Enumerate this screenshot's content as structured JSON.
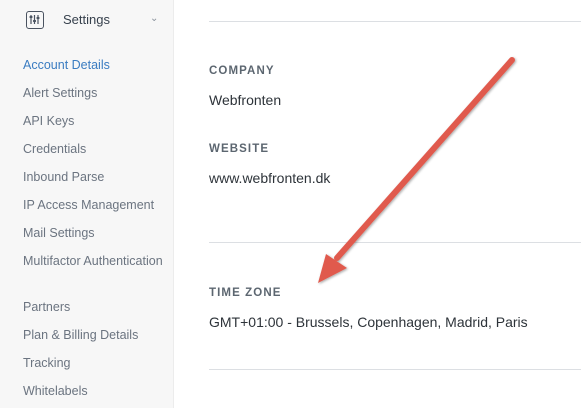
{
  "sidebar": {
    "title": "Settings",
    "icon": "settings-sliders-icon",
    "items": [
      {
        "label": "Account Details",
        "active": true
      },
      {
        "label": "Alert Settings"
      },
      {
        "label": "API Keys"
      },
      {
        "label": "Credentials"
      },
      {
        "label": "Inbound Parse"
      },
      {
        "label": "IP Access Management"
      },
      {
        "label": "Mail Settings"
      },
      {
        "label": "Multifactor Authentication"
      },
      {
        "label": "Partners"
      },
      {
        "label": "Plan & Billing Details"
      },
      {
        "label": "Tracking"
      },
      {
        "label": "Whitelabels"
      }
    ]
  },
  "main": {
    "company": {
      "label": "COMPANY",
      "value": "Webfronten"
    },
    "website": {
      "label": "WEBSITE",
      "value": "www.webfronten.dk"
    },
    "timezone": {
      "label": "TIME ZONE",
      "value": "GMT+01:00 - Brussels, Copenhagen, Madrid, Paris"
    }
  },
  "colors": {
    "accent": "#3a7cc1",
    "annotation_arrow": "#e05a4e"
  }
}
